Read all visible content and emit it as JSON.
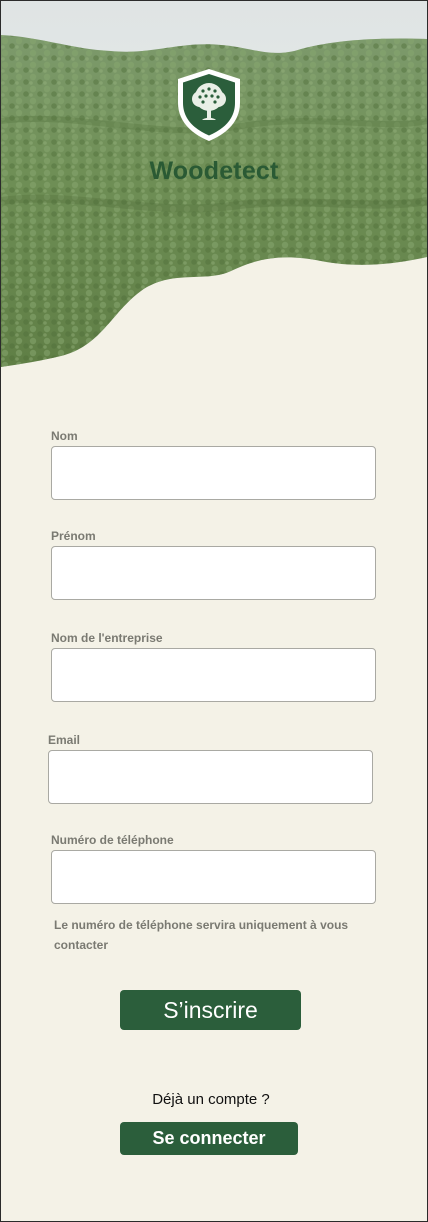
{
  "app": {
    "name": "Woodetect"
  },
  "form": {
    "fields": [
      {
        "label": "Nom",
        "value": "",
        "placeholder": ""
      },
      {
        "label": "Prénom",
        "value": "",
        "placeholder": ""
      },
      {
        "label": "Nom de l'entreprise",
        "value": "",
        "placeholder": ""
      },
      {
        "label": "Email",
        "value": "",
        "placeholder": ""
      },
      {
        "label": "Numéro de téléphone",
        "value": "",
        "placeholder": ""
      }
    ],
    "phone_helper": "Le numéro de téléphone servira uniquement à vous contacter",
    "submit_label": "S’inscrire"
  },
  "login": {
    "prompt": "Déjà un compte ?",
    "button_label": "Se connecter"
  },
  "icons": {
    "logo": "tree-shield-icon",
    "hero": "forest-hills-image"
  },
  "colors": {
    "brand_green": "#2b5e3b",
    "background": "#f4f2e7",
    "label_gray": "#7a7a72"
  }
}
